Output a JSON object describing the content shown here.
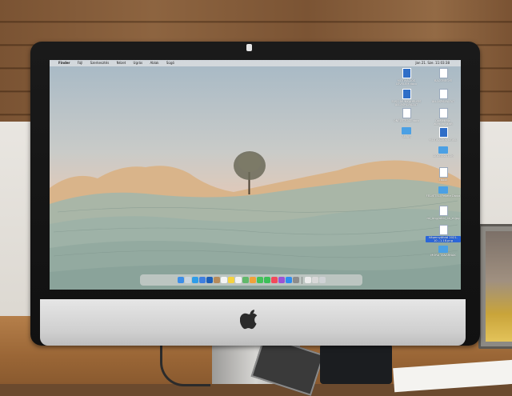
{
  "scene": {
    "description_tags": [
      "imac",
      "desk",
      "wooden-wall"
    ]
  },
  "menubar": {
    "app_name": "Finder",
    "items": [
      "Fájl",
      "Szerkesztés",
      "Nézet",
      "Ugrás",
      "Ablak",
      "Súgó"
    ],
    "clock": "Jan 21. Sze. 11:03:38"
  },
  "desktop_icons": [
    {
      "label": "MOTIVÁCIÓS LEVELEM.docx",
      "kind": "doc-blue"
    },
    {
      "label": "BÁCSMEGYE",
      "kind": "doc"
    },
    {
      "label": "ELSŐ MUNKAHELYES ÁLLÁSPÁLYÁZAT",
      "kind": "doc-blue"
    },
    {
      "label": "ÁLLÁSPÁLYÁZAT",
      "kind": "doc"
    },
    {
      "label": "ÖNÉLETRAJZ.docx",
      "kind": "doc"
    },
    {
      "label": "Önéletrajz, álláspályázat",
      "kind": "doc"
    },
    {
      "label": "ÁLLÁS",
      "kind": "folder"
    },
    {
      "label": "MOTIVÁCIÓS LEVEL",
      "kind": "doc-blue"
    },
    {
      "label": "DOLGOZATOK",
      "kind": "folder"
    },
    {
      "label": "Ebook",
      "kind": "doc"
    },
    {
      "label": "FELVÉTELI Fekete Dávid",
      "kind": "folder"
    },
    {
      "label": "mi_Angyaltól_4k_ei.jpg",
      "kind": "doc"
    },
    {
      "label": "Képernyőfotó 2021-10...1.18.png",
      "kind": "doc",
      "selected": true
    },
    {
      "label": "MÓRA TANÁRNAK",
      "kind": "folder"
    }
  ],
  "dock": {
    "apps": [
      {
        "name": "finder",
        "color": "#3d8ee8"
      },
      {
        "name": "launchpad",
        "color": "#c9d4df"
      },
      {
        "name": "safari",
        "color": "#2f9de8"
      },
      {
        "name": "mail",
        "color": "#3f7fe0"
      },
      {
        "name": "outlook",
        "color": "#1c5fb8"
      },
      {
        "name": "contacts",
        "color": "#b58b5c"
      },
      {
        "name": "calendar",
        "color": "#f4f4f4"
      },
      {
        "name": "notes",
        "color": "#f5d340"
      },
      {
        "name": "reminders",
        "color": "#f2f2f2"
      },
      {
        "name": "maps",
        "color": "#62b86b"
      },
      {
        "name": "photos",
        "color": "#f0a23b"
      },
      {
        "name": "messages",
        "color": "#44c25a"
      },
      {
        "name": "facetime",
        "color": "#3cbf58"
      },
      {
        "name": "music",
        "color": "#f24a5b"
      },
      {
        "name": "podcasts",
        "color": "#9b53d6"
      },
      {
        "name": "app-store",
        "color": "#2f8df0"
      },
      {
        "name": "system-preferences",
        "color": "#8c8c8c"
      }
    ],
    "trailing": [
      {
        "name": "document",
        "color": "#ececec"
      },
      {
        "name": "image",
        "color": "#d8d8d8"
      },
      {
        "name": "trash",
        "color": "#cfd2d5"
      }
    ]
  }
}
